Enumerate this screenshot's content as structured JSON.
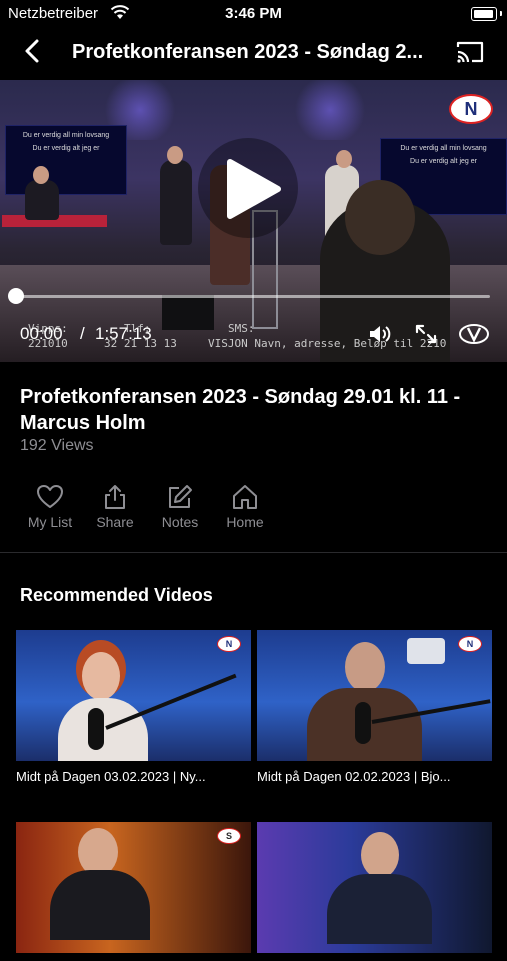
{
  "status_bar": {
    "carrier": "Netzbetreiber",
    "time": "3:46 PM"
  },
  "nav": {
    "title": "Profetkonferansen 2023 - Søndag 2..."
  },
  "player": {
    "current_time": "00:00",
    "separator": "/",
    "duration": "1:57:13",
    "progress_fraction": 0,
    "overlay_screen_text": "Du er verdig all min lovsang",
    "overlay_screen_text_2": "Du er verdig alt jeg er",
    "ticker": {
      "vipps_label": "Vipps:",
      "vipps_value": "221010",
      "tlf_label": "Tlf:",
      "tlf_value": "32 21 13 13",
      "sms_label": "SMS:",
      "sms_value": "VISJON Navn, adresse, Beløp til 2210"
    },
    "logo_text": "N"
  },
  "video_info": {
    "title": "Profetkonferansen 2023 - Søndag 29.01 kl. 11 - Marcus Holm",
    "views": "192 Views"
  },
  "actions": [
    {
      "label": "My List",
      "icon": "heart-icon"
    },
    {
      "label": "Share",
      "icon": "share-icon"
    },
    {
      "label": "Notes",
      "icon": "edit-icon"
    },
    {
      "label": "Home",
      "icon": "home-icon"
    }
  ],
  "recommended": {
    "heading": "Recommended Videos",
    "items": [
      {
        "title": "Midt på Dagen 03.02.2023 | Ny..."
      },
      {
        "title": "Midt på Dagen 02.02.2023 | Bjo..."
      },
      {
        "title": ""
      },
      {
        "title": ""
      }
    ]
  },
  "colors": {
    "background": "#000000",
    "secondary_text": "#8e8e93",
    "logo_red": "#dd2222"
  }
}
